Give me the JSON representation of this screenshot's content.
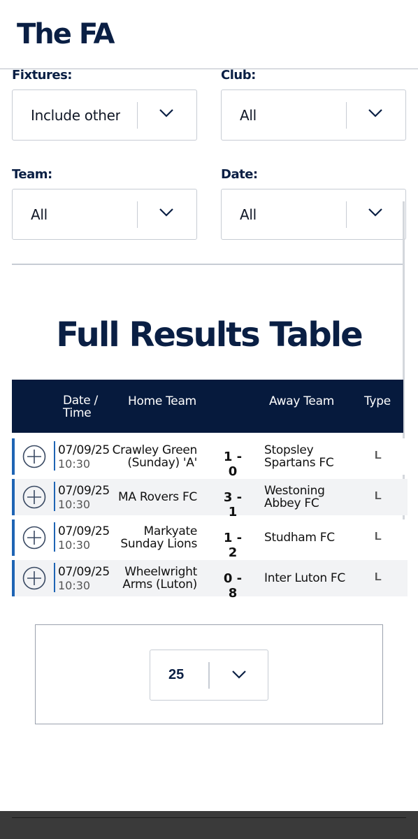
{
  "header": {
    "logo_text": "The FA"
  },
  "filters": {
    "fixtures": {
      "label": "Fixtures:",
      "value": "Include other g"
    },
    "club": {
      "label": "Club:",
      "value": "All"
    },
    "team": {
      "label": "Team:",
      "value": "All"
    },
    "date": {
      "label": "Date:",
      "value": "All"
    }
  },
  "results": {
    "title": "Full Results Table",
    "columns": {
      "date_line1": "Date /",
      "date_line2": "Time",
      "home": "Home Team",
      "away": "Away Team",
      "type": "Type"
    },
    "rows": [
      {
        "date": "07/09/25",
        "time": "10:30",
        "home_l1": "Crawley Green",
        "home_l2": "(Sunday) 'A'",
        "score": "1 - 0",
        "away_l1": "Stopsley",
        "away_l2": "Spartans FC",
        "type": "L"
      },
      {
        "date": "07/09/25",
        "time": "10:30",
        "home_l1": "MA Rovers FC",
        "home_l2": "",
        "score": "3 - 1",
        "away_l1": "Westoning",
        "away_l2": "Abbey FC",
        "type": "L"
      },
      {
        "date": "07/09/25",
        "time": "10:30",
        "home_l1": "Markyate",
        "home_l2": "Sunday Lions",
        "score": "1 - 2",
        "away_l1": "Studham FC",
        "away_l2": "",
        "type": "L"
      },
      {
        "date": "07/09/25",
        "time": "10:30",
        "home_l1": "Wheelwright",
        "home_l2": "Arms (Luton)",
        "score": "0 - 8",
        "away_l1": "Inter Luton FC",
        "away_l2": "",
        "type": "L"
      }
    ]
  },
  "pagination": {
    "page_size": "25"
  },
  "colors": {
    "navy": "#0a1f44",
    "header_bg": "#061a3d",
    "accent_blue": "#1e64b4"
  },
  "icons": {
    "dropdown": "chevron-down-icon",
    "expand": "plus-circle-icon"
  }
}
